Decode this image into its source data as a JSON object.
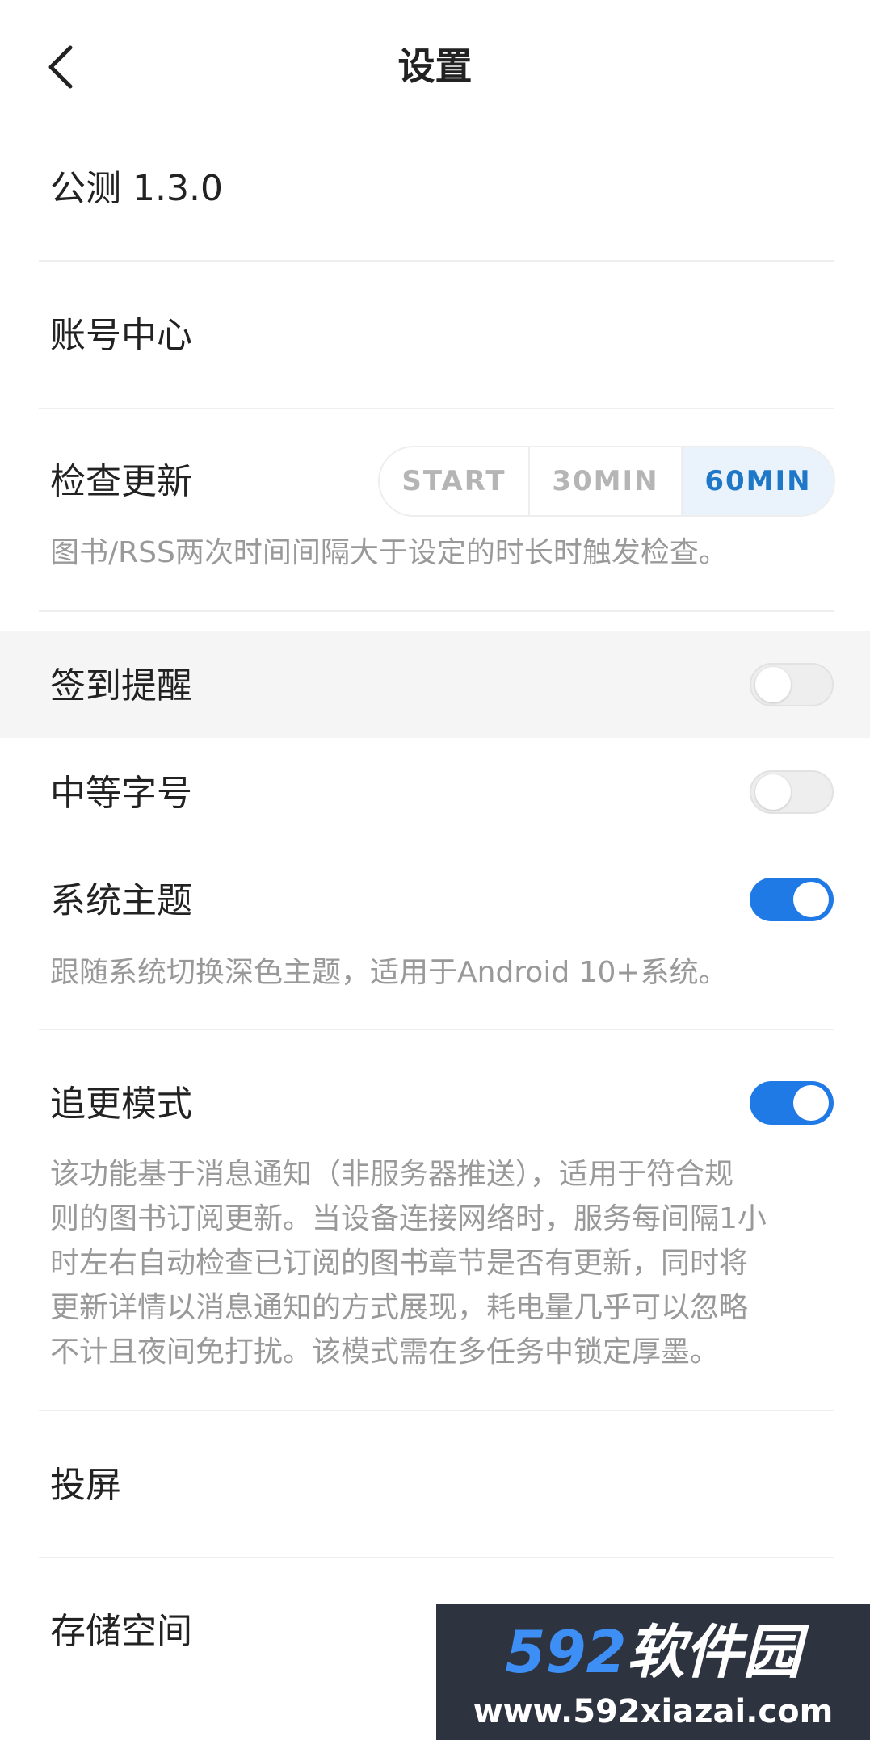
{
  "header": {
    "title": "设置",
    "back_icon": "chevron-left-icon"
  },
  "version": {
    "label": "公测 1.3.0"
  },
  "account": {
    "label": "账号中心"
  },
  "check_update": {
    "label": "检查更新",
    "options": [
      "START",
      "30MIN",
      "60MIN"
    ],
    "selected": "60MIN",
    "description": "图书/RSS两次时间间隔大于设定的时长时触发检查。"
  },
  "checkin_reminder": {
    "label": "签到提醒",
    "enabled": false
  },
  "medium_font": {
    "label": "中等字号",
    "enabled": false
  },
  "system_theme": {
    "label": "系统主题",
    "enabled": true,
    "description": "跟随系统切换深色主题，适用于Android 10+系统。"
  },
  "follow_mode": {
    "label": "追更模式",
    "enabled": true,
    "description_lines": [
      "该功能基于消息通知（非服务器推送），适用于符合规",
      "则的图书订阅更新。当设备连接网络时，服务每间隔1小",
      "时左右自动检查已订阅的图书章节是否有更新，同时将",
      "更新详情以消息通知的方式展现，耗电量几乎可以忽略",
      "不计且夜间免打扰。该模式需在多任务中锁定厚墨。"
    ]
  },
  "cast": {
    "label": "投屏"
  },
  "storage": {
    "label": "存储空间"
  },
  "watermark": {
    "brand_number": "592",
    "brand_text": "软件园",
    "url": "www.592xiazai.com"
  },
  "colors": {
    "accent": "#1f7ae6",
    "selected_segment_text": "#1f77c7",
    "selected_segment_bg": "#eaf3fb",
    "description_text": "#999999",
    "highlight_row": "#f5f5f5"
  }
}
